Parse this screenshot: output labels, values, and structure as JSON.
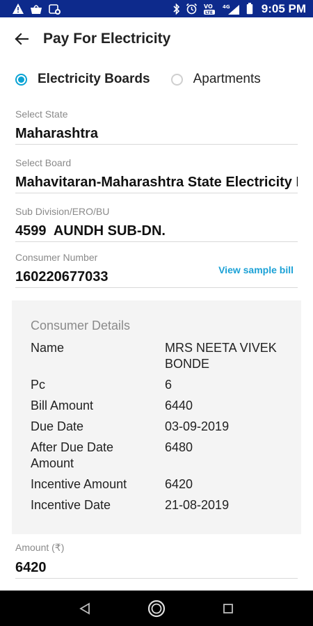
{
  "status_bar": {
    "time": "9:05 PM",
    "network_label": "4G",
    "volte_label": "VoLTE"
  },
  "app_bar": {
    "title": "Pay For Electricity"
  },
  "tabs": [
    {
      "label": "Electricity Boards",
      "selected": true
    },
    {
      "label": "Apartments",
      "selected": false
    }
  ],
  "form": {
    "state": {
      "label": "Select State",
      "value": "Maharashtra"
    },
    "board": {
      "label": "Select Board",
      "value": "Mahavitaran-Maharashtra State Electricity D"
    },
    "subdivision": {
      "label": "Sub Division/ERO/BU",
      "value": "4599  AUNDH SUB-DN."
    },
    "consumer_number": {
      "label": "Consumer Number",
      "value": "160220677033",
      "link": "View sample bill"
    },
    "amount": {
      "label": "Amount (₹)",
      "value": "6420"
    }
  },
  "consumer_details": {
    "title": "Consumer Details",
    "rows": [
      {
        "key": "Name",
        "value": "MRS NEETA VIVEK BONDE"
      },
      {
        "key": "Pc",
        "value": "6"
      },
      {
        "key": "Bill Amount",
        "value": "6440"
      },
      {
        "key": "Due Date",
        "value": "03-09-2019"
      },
      {
        "key": "After Due Date Amount",
        "value": "6480"
      },
      {
        "key": "Incentive Amount",
        "value": "6420"
      },
      {
        "key": "Incentive Date",
        "value": "21-08-2019"
      }
    ]
  },
  "colors": {
    "status_bar": "#0d2a8c",
    "accent": "#0aa3d4",
    "link": "#1ba1d6",
    "card_background": "#f4f4f4"
  }
}
